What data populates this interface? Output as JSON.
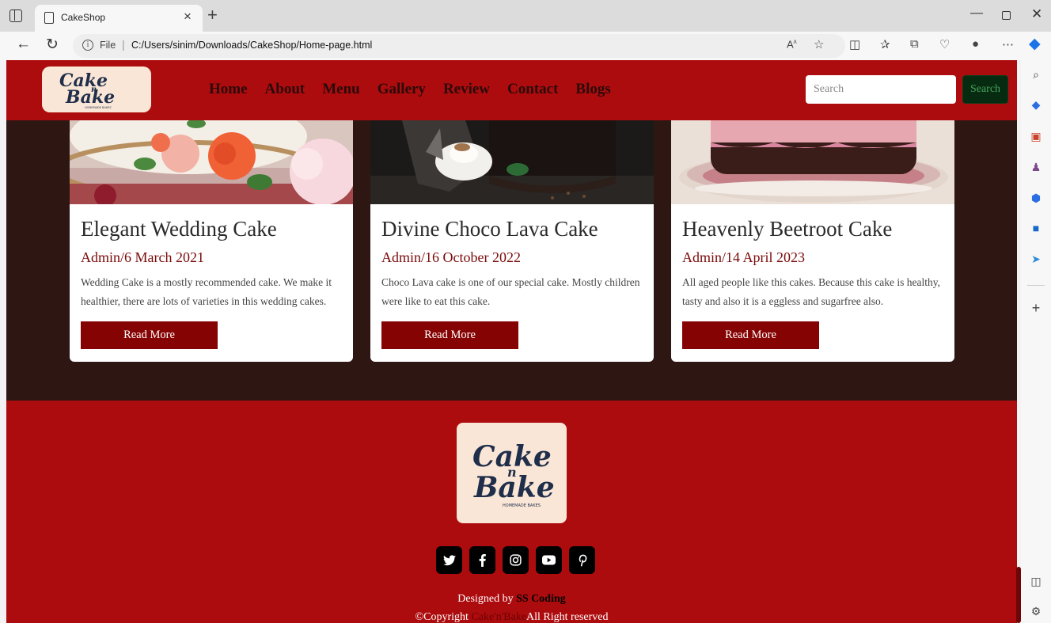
{
  "browser": {
    "tab_title": "CakeShop",
    "url_scheme_label": "File",
    "url": "C:/Users/sinim/Downloads/CakeShop/Home-page.html"
  },
  "site": {
    "logo_alt": "Cake n Bake",
    "logo_line1": "Cake",
    "logo_n": "n",
    "logo_line2": "Bake",
    "logo_tagline": "HOMEMADE BAKES",
    "nav": [
      "Home",
      "About",
      "Menu",
      "Gallery",
      "Review",
      "Contact",
      "Blogs"
    ],
    "search": {
      "placeholder": "Search",
      "button": "Search"
    }
  },
  "blogs": [
    {
      "title": "Elegant Wedding Cake",
      "meta": "Admin/6 March 2021",
      "text": "Wedding Cake is a mostly recommended cake. We make it healthier, there are lots of varieties in this wedding cakes.",
      "button": "Read More"
    },
    {
      "title": "Divine Choco Lava Cake",
      "meta": "Admin/16 October 2022",
      "text": "Choco Lava cake is one of our special cake. Mostly children were like to eat this cake.",
      "button": "Read More"
    },
    {
      "title": "Heavenly Beetroot Cake",
      "meta": "Admin/14 April 2023",
      "text": "All aged people like this cakes. Because this cake is healthy, tasty and also it is a eggless and sugarfree also.",
      "button": "Read More"
    }
  ],
  "footer": {
    "socials": [
      "twitter-icon",
      "facebook-icon",
      "instagram-icon",
      "youtube-icon",
      "pinterest-icon"
    ],
    "designed_prefix": "Designed by ",
    "designer": "SS Coding",
    "copyright_prefix": "©Copyright ",
    "brand": "Cake'n'Bake",
    "rights": "All Right reserved"
  },
  "colors": {
    "brand_red": "#ad0c0e",
    "dark_band": "#2e1613",
    "button_red": "#860303",
    "logo_bg": "#fae6d6",
    "logo_ink": "#1f2e4a"
  }
}
